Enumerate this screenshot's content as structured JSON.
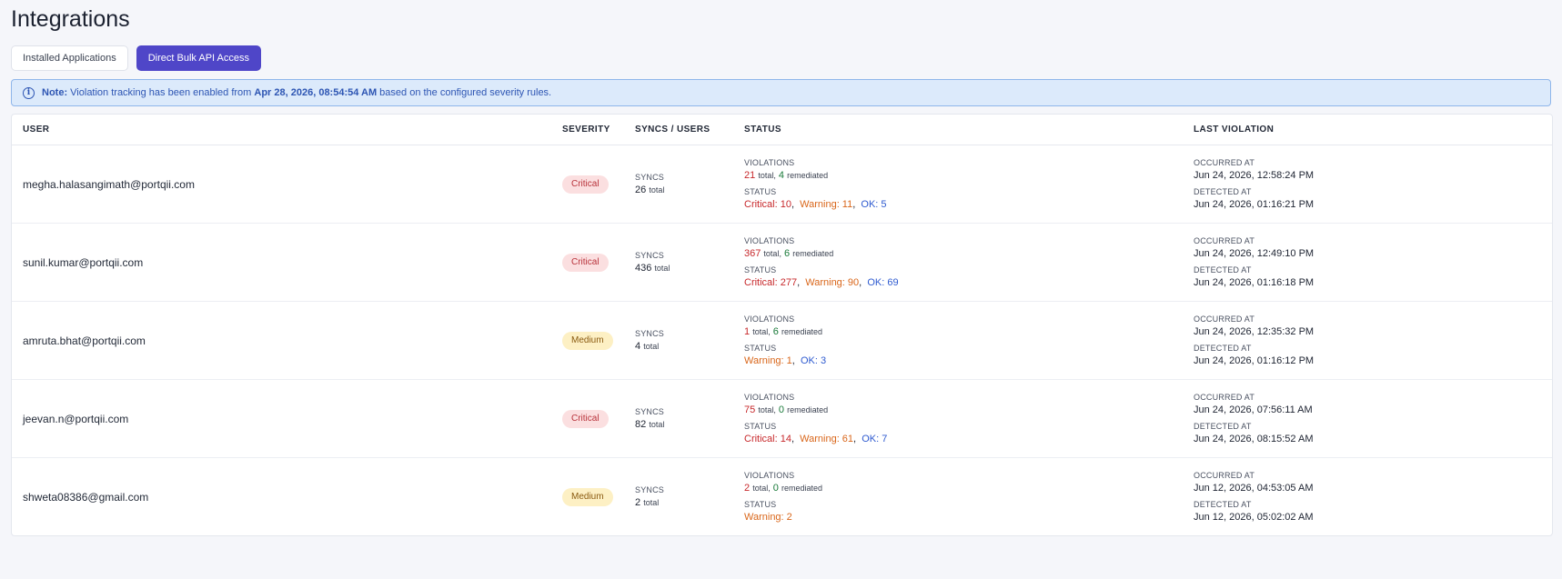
{
  "page_title": "Integrations",
  "tabs": [
    {
      "label": "Installed Applications",
      "active": false
    },
    {
      "label": "Direct Bulk API Access",
      "active": true
    }
  ],
  "note": {
    "prefix": "Note:",
    "text1": "Violation tracking has been enabled from",
    "date": "Apr 28, 2026, 08:54:54 AM",
    "text2": "based on the configured severity rules."
  },
  "columns": {
    "user": "USER",
    "severity": "SEVERITY",
    "syncs": "SYNCS / USERS",
    "status": "STATUS",
    "last": "LAST VIOLATION"
  },
  "labels": {
    "syncs": "SYNCS",
    "total": "total",
    "violations": "VIOLATIONS",
    "remediated": "remediated",
    "status": "STATUS",
    "occurred": "OCCURRED AT",
    "detected": "DETECTED AT"
  },
  "rows": [
    {
      "user": "megha.halasangimath@portqii.com",
      "severity": "Critical",
      "syncs": "26",
      "violations": "21",
      "remediated": "4",
      "critical": "Critical: 10",
      "warning": "Warning: 11",
      "ok": "OK: 5",
      "occurred": "Jun 24, 2026, 12:58:24 PM",
      "detected": "Jun 24, 2026, 01:16:21 PM"
    },
    {
      "user": "sunil.kumar@portqii.com",
      "severity": "Critical",
      "syncs": "436",
      "violations": "367",
      "remediated": "6",
      "critical": "Critical: 277",
      "warning": "Warning: 90",
      "ok": "OK: 69",
      "occurred": "Jun 24, 2026, 12:49:10 PM",
      "detected": "Jun 24, 2026, 01:16:18 PM"
    },
    {
      "user": "amruta.bhat@portqii.com",
      "severity": "Medium",
      "syncs": "4",
      "violations": "1",
      "remediated": "6",
      "critical": "",
      "warning": "Warning: 1",
      "ok": "OK: 3",
      "occurred": "Jun 24, 2026, 12:35:32 PM",
      "detected": "Jun 24, 2026, 01:16:12 PM"
    },
    {
      "user": "jeevan.n@portqii.com",
      "severity": "Critical",
      "syncs": "82",
      "violations": "75",
      "remediated": "0",
      "critical": "Critical: 14",
      "warning": "Warning: 61",
      "ok": "OK: 7",
      "occurred": "Jun 24, 2026, 07:56:11 AM",
      "detected": "Jun 24, 2026, 08:15:52 AM"
    },
    {
      "user": "shweta08386@gmail.com",
      "severity": "Medium",
      "syncs": "2",
      "violations": "2",
      "remediated": "0",
      "critical": "",
      "warning": "Warning: 2",
      "ok": "",
      "occurred": "Jun 12, 2026, 04:53:05 AM",
      "detected": "Jun 12, 2026, 05:02:02 AM"
    }
  ]
}
